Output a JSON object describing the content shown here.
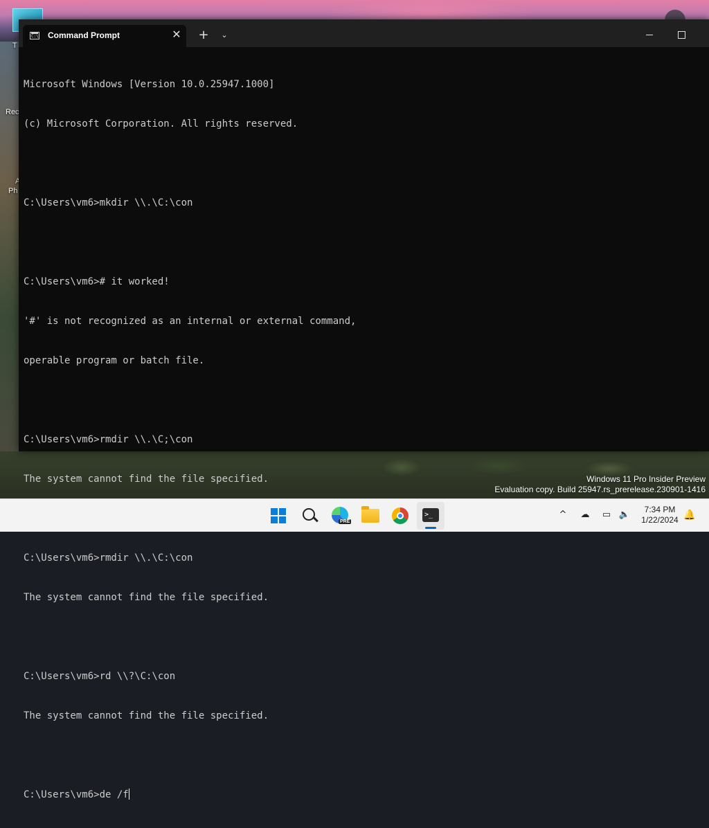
{
  "desktop": {
    "labels": [
      "T",
      "Rec",
      "A",
      "Ph"
    ]
  },
  "window": {
    "tab_title": "Command Prompt",
    "tab_close": "✕",
    "new_tab": "+",
    "dropdown": "⌄",
    "terminal_lines": [
      "Microsoft Windows [Version 10.0.25947.1000]",
      "(c) Microsoft Corporation. All rights reserved.",
      "",
      "C:\\Users\\vm6>mkdir \\\\.\\C:\\con",
      "",
      "C:\\Users\\vm6># it worked!",
      "'#' is not recognized as an internal or external command,",
      "operable program or batch file.",
      "",
      "C:\\Users\\vm6>rmdir \\\\.\\C;\\con",
      "The system cannot find the file specified.",
      "",
      "C:\\Users\\vm6>rmdir \\\\.\\C:\\con",
      "The system cannot find the file specified.",
      "",
      "C:\\Users\\vm6>rd \\\\?\\C:\\con",
      "The system cannot find the file specified.",
      ""
    ],
    "prompt_line": "C:\\Users\\vm6>de /f"
  },
  "watermark": {
    "line1": "Windows 11 Pro Insider Preview",
    "line2": "Evaluation copy. Build 25947.rs_prerelease.230901-1416"
  },
  "taskbar": {
    "items": [
      "start",
      "search",
      "edge-beta",
      "file-explorer",
      "chrome",
      "terminal"
    ],
    "edge_badge": "PRE",
    "terminal_glyph": ">_",
    "tray": {
      "chevron": "^",
      "onedrive": "☁",
      "display": "▭",
      "sound": "🔈"
    },
    "time": "7:34 PM",
    "date": "1/22/2024",
    "bell": "🔔"
  },
  "colors": {
    "terminal_bg": "#0c0c0c",
    "terminal_fg": "#cccccc",
    "titlebar_bg": "#202020",
    "taskbar_bg": "#f3f3f3",
    "accent": "#0067c0"
  }
}
